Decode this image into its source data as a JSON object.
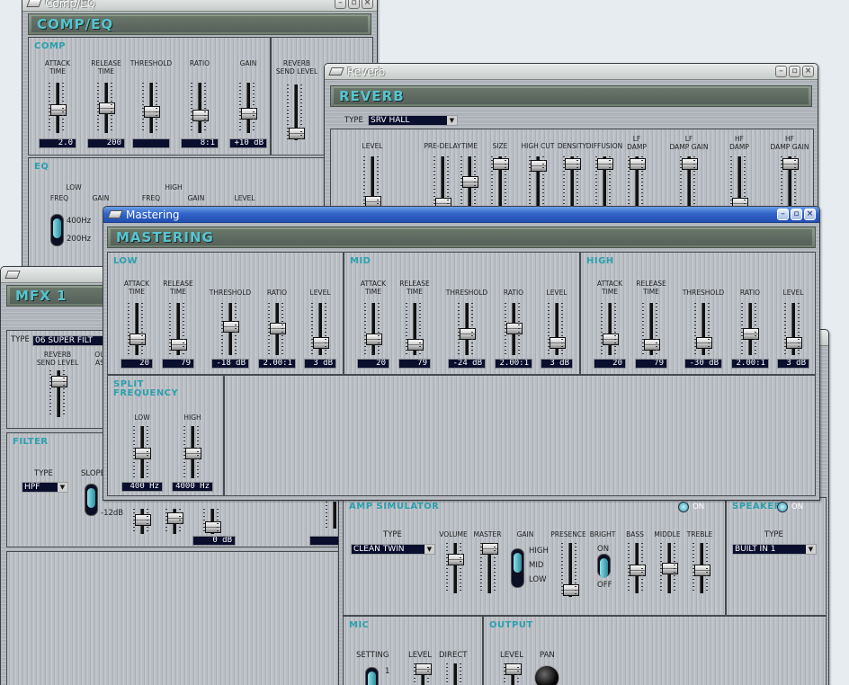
{
  "compeq": {
    "window_title": "Comp/EQ",
    "header": "COMP/EQ",
    "comp_label": "COMP",
    "eq_label": "EQ",
    "comp_controls": [
      {
        "caption": "ATTACK\nTIME",
        "value": "2.0"
      },
      {
        "caption": "RELEASE\nTIME",
        "value": "200"
      },
      {
        "caption": "THRESHOLD",
        "value": ""
      },
      {
        "caption": "RATIO",
        "value": "8:1"
      },
      {
        "caption": "GAIN",
        "value": "+10 dB"
      }
    ],
    "reverb_send": "REVERB\nSEND LEVEL",
    "eq_low": "LOW",
    "eq_high": "HIGH",
    "eq_freq": "FREQ",
    "eq_gain": "GAIN",
    "eq_level": "LEVEL",
    "eq_400": "400Hz",
    "eq_200": "200Hz"
  },
  "reverb": {
    "window_title": "Reverb",
    "header": "REVERB",
    "type_label": "TYPE",
    "type_value": "SRV HALL",
    "controls": [
      "LEVEL",
      "PRE-DELAY",
      "TIME",
      "SIZE",
      "HIGH CUT",
      "DENSITY",
      "DIFFUSION",
      "LF\nDAMP",
      "LF\nDAMP GAIN",
      "HF\nDAMP",
      "HF\nDAMP GAIN"
    ]
  },
  "mfx": {
    "window_title": "",
    "header": "MFX 1",
    "type_label": "TYPE",
    "type_value": "06 SUPER FILT",
    "reverb_send": "REVERB\nSEND LEVEL",
    "out_assign": "OU\nAS",
    "filter_label": "FILTER",
    "ftype_label": "TYPE",
    "ftype_value": "HPF",
    "slope_label": "SLOPE",
    "slope_12": "-12dB",
    "gain_value": "0 dB"
  },
  "amp": {
    "amp_label": "AMP SIMULATOR",
    "amp_on": "ON",
    "speaker_label": "SPEAKER",
    "speaker_on": "ON",
    "type_label": "TYPE",
    "type_value": "CLEAN TWIN",
    "volume": "VOLUME",
    "master": "MASTER",
    "gain": "GAIN",
    "gain_high": "HIGH",
    "gain_mid": "MID",
    "gain_low": "LOW",
    "presence": "PRESENCE",
    "bright": "BRIGHT",
    "bright_on": "ON",
    "bright_off": "OFF",
    "bass": "BASS",
    "middle": "MIDDLE",
    "treble": "TREBLE",
    "speaker_type_label": "TYPE",
    "speaker_type_value": "BUILT IN 1",
    "mic_label": "MIC",
    "output_label": "OUTPUT",
    "setting": "SETTING",
    "level": "LEVEL",
    "direct": "DIRECT",
    "out_level": "LEVEL",
    "pan": "PAN",
    "set1": "1"
  },
  "mastering": {
    "window_title": "Mastering",
    "header": "MASTERING",
    "bands": [
      {
        "label": "LOW",
        "controls": [
          {
            "caption": "ATTACK\nTIME",
            "value": "20"
          },
          {
            "caption": "RELEASE\nTIME",
            "value": "79"
          },
          {
            "caption": "THRESHOLD",
            "value": "-18 dB"
          },
          {
            "caption": "RATIO",
            "value": "2.00:1"
          },
          {
            "caption": "LEVEL",
            "value": "3 dB"
          }
        ]
      },
      {
        "label": "MID",
        "controls": [
          {
            "caption": "ATTACK\nTIME",
            "value": "20"
          },
          {
            "caption": "RELEASE\nTIME",
            "value": "79"
          },
          {
            "caption": "THRESHOLD",
            "value": "-24 dB"
          },
          {
            "caption": "RATIO",
            "value": "2.00:1"
          },
          {
            "caption": "LEVEL",
            "value": "3 dB"
          }
        ]
      },
      {
        "label": "HIGH",
        "controls": [
          {
            "caption": "ATTACK\nTIME",
            "value": "20"
          },
          {
            "caption": "RELEASE\nTIME",
            "value": "79"
          },
          {
            "caption": "THRESHOLD",
            "value": "-30 dB"
          },
          {
            "caption": "RATIO",
            "value": "2.00:1"
          },
          {
            "caption": "LEVEL",
            "value": "3 dB"
          }
        ]
      }
    ],
    "split_label": "SPLIT\nFREQUENCY",
    "split": [
      {
        "caption": "LOW",
        "value": "400 Hz"
      },
      {
        "caption": "HIGH",
        "value": "4000 Hz"
      }
    ]
  }
}
